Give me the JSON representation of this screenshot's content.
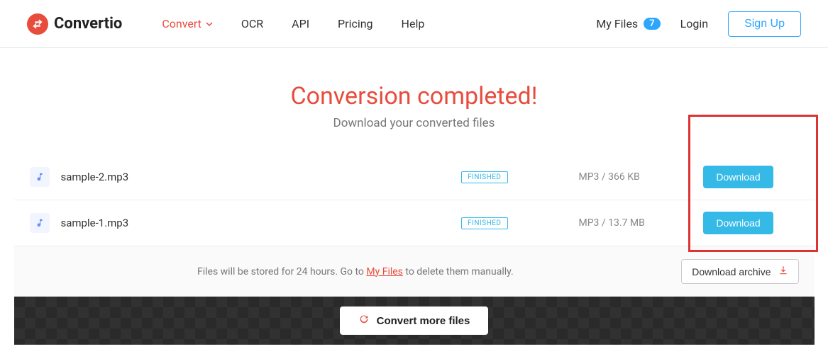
{
  "brand": "Convertio",
  "nav": {
    "convert": "Convert",
    "ocr": "OCR",
    "api": "API",
    "pricing": "Pricing",
    "help": "Help"
  },
  "header_right": {
    "my_files": "My Files",
    "my_files_count": "7",
    "login": "Login",
    "signup": "Sign Up"
  },
  "title": {
    "heading": "Conversion completed!",
    "sub": "Download your converted files"
  },
  "files": [
    {
      "name": "sample-2.mp3",
      "status": "FINISHED",
      "info": "MP3 / 366 KB",
      "download": "Download"
    },
    {
      "name": "sample-1.mp3",
      "status": "FINISHED",
      "info": "MP3 / 13.7 MB",
      "download": "Download"
    }
  ],
  "footer": {
    "text_before": "Files will be stored for 24 hours. Go to ",
    "link": "My Files",
    "text_after": " to delete them manually.",
    "archive": "Download archive"
  },
  "bottom": {
    "convert_more": "Convert more files"
  }
}
